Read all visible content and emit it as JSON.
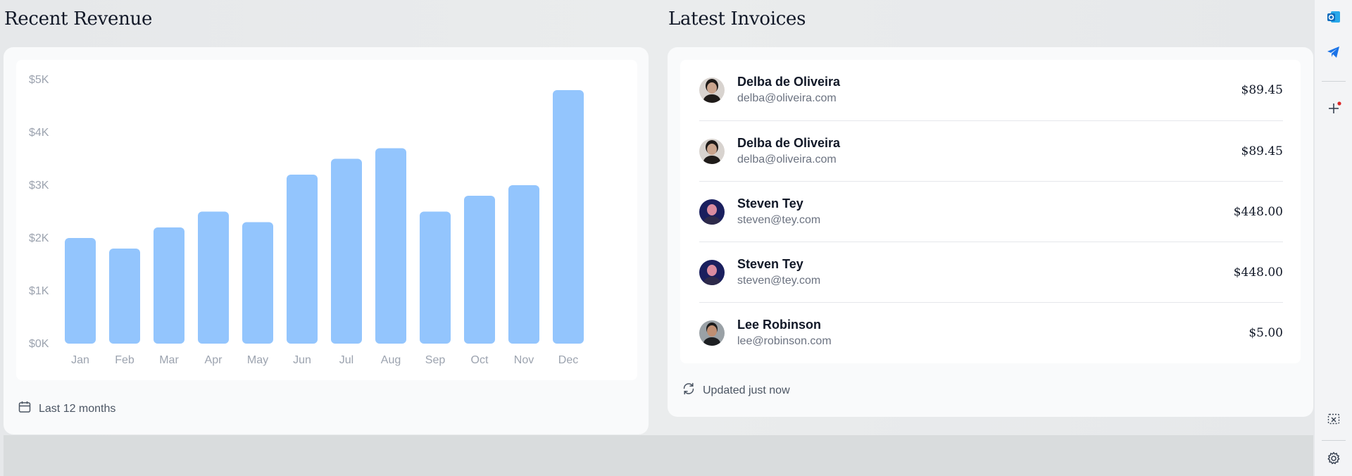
{
  "revenue": {
    "title": "Recent Revenue",
    "footer": "Last 12 months"
  },
  "chart_data": {
    "type": "bar",
    "categories": [
      "Jan",
      "Feb",
      "Mar",
      "Apr",
      "May",
      "Jun",
      "Jul",
      "Aug",
      "Sep",
      "Oct",
      "Nov",
      "Dec"
    ],
    "values": [
      2000,
      1800,
      2200,
      2500,
      2300,
      3200,
      3500,
      3700,
      2500,
      2800,
      3000,
      4800
    ],
    "y_ticks": [
      "$0K",
      "$1K",
      "$2K",
      "$3K",
      "$4K",
      "$5K"
    ],
    "ylim": [
      0,
      5000
    ],
    "bar_color": "#93c5fd",
    "title": "",
    "xlabel": "",
    "ylabel": ""
  },
  "invoices": {
    "title": "Latest Invoices",
    "footer": "Updated just now",
    "rows": [
      {
        "name": "Delba de Oliveira",
        "email": "delba@oliveira.com",
        "amount": "$89.45"
      },
      {
        "name": "Delba de Oliveira",
        "email": "delba@oliveira.com",
        "amount": "$89.45"
      },
      {
        "name": "Steven Tey",
        "email": "steven@tey.com",
        "amount": "$448.00"
      },
      {
        "name": "Steven Tey",
        "email": "steven@tey.com",
        "amount": "$448.00"
      },
      {
        "name": "Lee Robinson",
        "email": "lee@robinson.com",
        "amount": "$5.00"
      }
    ]
  },
  "sidebar": {
    "icons": [
      "outlook-icon",
      "telegram-icon",
      "add-icon",
      "screenshot-icon",
      "gear-icon"
    ],
    "accent": "#0f6cbd"
  }
}
